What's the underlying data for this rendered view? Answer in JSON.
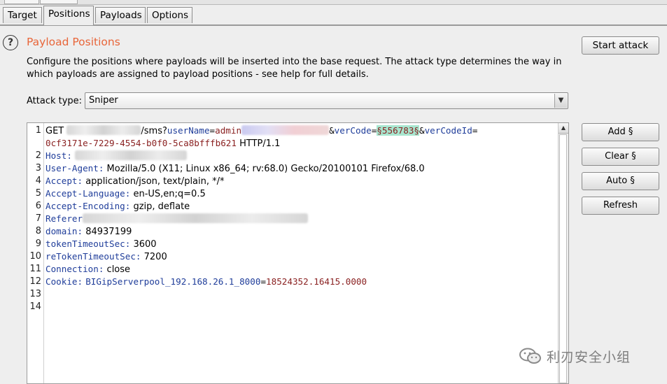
{
  "tabs": [
    {
      "label": "Target",
      "active": false
    },
    {
      "label": "Positions",
      "active": true
    },
    {
      "label": "Payloads",
      "active": false
    },
    {
      "label": "Options",
      "active": false
    }
  ],
  "section": {
    "help_icon": "?",
    "title": "Payload Positions",
    "description": "Configure the positions where payloads will be inserted into the base request. The attack type determines the way in which payloads are assigned to payload positions - see help for full details."
  },
  "buttons": {
    "start_attack": "Start attack",
    "add": "Add §",
    "clear": "Clear §",
    "auto": "Auto §",
    "refresh": "Refresh"
  },
  "attack_type": {
    "label": "Attack type:",
    "value": "Sniper"
  },
  "editor": {
    "line_numbers": [
      "1",
      "",
      "2",
      "3",
      "4",
      "5",
      "6",
      "7",
      "8",
      "9",
      "10",
      "11",
      "12",
      "13",
      "14"
    ],
    "line1": {
      "method": "GET",
      "path": "/sms?",
      "param1_key": "userName",
      "eq": "=",
      "param1_value": "admin",
      "amp": "&",
      "param2_key": "verCode",
      "marked_value": "§556783§",
      "param3_key": "verCodeId"
    },
    "line1_wrap": {
      "value": "0cf3171e-7229-4554-b0f0-5ca8bfffb621",
      "protocol": "HTTP/1.1"
    },
    "host_key": "Host:",
    "ua_key": "User-Agent:",
    "ua_value": "Mozilla/5.0 (X11; Linux x86_64; rv:68.0) Gecko/20100101 Firefox/68.0",
    "accept_key": "Accept:",
    "accept_value": "application/json, text/plain, */*",
    "accept_lang_key": "Accept-Language:",
    "accept_lang_value": "en-US,en;q=0.5",
    "accept_enc_key": "Accept-Encoding:",
    "accept_enc_value": "gzip, deflate",
    "referer_key": "Referer",
    "domain_key": "domain:",
    "domain_value": "84937199",
    "token_key": "tokenTimeoutSec:",
    "token_value": "3600",
    "retoken_key": "reTokenTimeoutSec:",
    "retoken_value": "7200",
    "connection_key": "Connection:",
    "connection_value": "close",
    "cookie_key": "Cookie:",
    "cookie_name": "BIGipServerpool_192.168.26.1_8000",
    "cookie_eq": "=",
    "cookie_value": "18524352.16415.0000"
  },
  "watermark": {
    "text": "利刃安全小组",
    "icon": "wechat-icon"
  },
  "colors": {
    "title": "#e8663a",
    "key": "#1f3d9a",
    "value": "#8a2121",
    "marker": "#a8e6cf"
  }
}
